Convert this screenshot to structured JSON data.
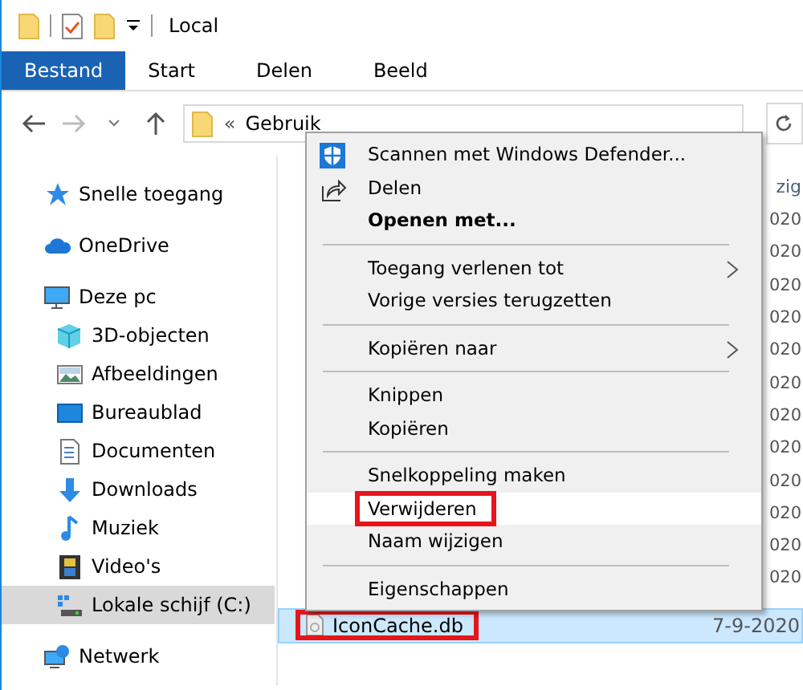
{
  "window": {
    "title": "Local"
  },
  "ribbon_tabs": [
    {
      "label": "Bestand",
      "selected": true
    },
    {
      "label": "Start",
      "selected": false
    },
    {
      "label": "Delen",
      "selected": false
    },
    {
      "label": "Beeld",
      "selected": false
    }
  ],
  "address_bar": {
    "overflow": "«",
    "path": "Gebruik"
  },
  "sidebar": {
    "items": [
      {
        "label": "Snelle toegang",
        "selected": false
      },
      {
        "label": "OneDrive",
        "selected": false
      },
      {
        "label": "Deze pc",
        "selected": false,
        "children": [
          {
            "label": "3D-objecten",
            "selected": false
          },
          {
            "label": "Afbeeldingen",
            "selected": false
          },
          {
            "label": "Bureaublad",
            "selected": false
          },
          {
            "label": "Documenten",
            "selected": false
          },
          {
            "label": "Downloads",
            "selected": false
          },
          {
            "label": "Muziek",
            "selected": false
          },
          {
            "label": "Video's",
            "selected": false
          },
          {
            "label": "Lokale schijf (C:)",
            "selected": true
          }
        ]
      },
      {
        "label": "Netwerk",
        "selected": false
      }
    ]
  },
  "file_list": {
    "column_header": "zig",
    "rows": [
      {
        "date": "020"
      },
      {
        "date": "020"
      },
      {
        "date": "020"
      },
      {
        "date": "020"
      },
      {
        "date": "020"
      },
      {
        "date": "020"
      },
      {
        "date": "020"
      },
      {
        "date": "020"
      },
      {
        "date": "020"
      },
      {
        "date": "020"
      },
      {
        "date": "020"
      },
      {
        "date": "020"
      },
      {
        "name": "IconCache.db",
        "date": "7-9-2020",
        "selected": true,
        "annotated": true
      }
    ]
  },
  "context_menu": {
    "items": [
      {
        "kind": "item",
        "label": "Scannen met Windows Defender...",
        "bold": false,
        "submenu": false,
        "highlighted": false,
        "annotated": false
      },
      {
        "kind": "item",
        "label": "Delen",
        "bold": false,
        "submenu": false,
        "highlighted": false,
        "annotated": false
      },
      {
        "kind": "item",
        "label": "Openen met...",
        "bold": true,
        "submenu": false,
        "highlighted": false,
        "annotated": false
      },
      {
        "kind": "separator"
      },
      {
        "kind": "item",
        "label": "Toegang verlenen tot",
        "bold": false,
        "submenu": true,
        "highlighted": false,
        "annotated": false
      },
      {
        "kind": "item",
        "label": "Vorige versies terugzetten",
        "bold": false,
        "submenu": false,
        "highlighted": false,
        "annotated": false
      },
      {
        "kind": "separator"
      },
      {
        "kind": "item",
        "label": "Kopiëren naar",
        "bold": false,
        "submenu": true,
        "highlighted": false,
        "annotated": false
      },
      {
        "kind": "separator"
      },
      {
        "kind": "item",
        "label": "Knippen",
        "bold": false,
        "submenu": false,
        "highlighted": false,
        "annotated": false
      },
      {
        "kind": "item",
        "label": "Kopiëren",
        "bold": false,
        "submenu": false,
        "highlighted": false,
        "annotated": false
      },
      {
        "kind": "separator"
      },
      {
        "kind": "item",
        "label": "Snelkoppeling maken",
        "bold": false,
        "submenu": false,
        "highlighted": false,
        "annotated": false
      },
      {
        "kind": "item",
        "label": "Verwijderen",
        "bold": false,
        "submenu": false,
        "highlighted": true,
        "annotated": true
      },
      {
        "kind": "item",
        "label": "Naam wijzigen",
        "bold": false,
        "submenu": false,
        "highlighted": false,
        "annotated": false
      },
      {
        "kind": "separator"
      },
      {
        "kind": "item",
        "label": "Eigenschappen",
        "bold": false,
        "submenu": false,
        "highlighted": false,
        "annotated": false
      }
    ]
  }
}
